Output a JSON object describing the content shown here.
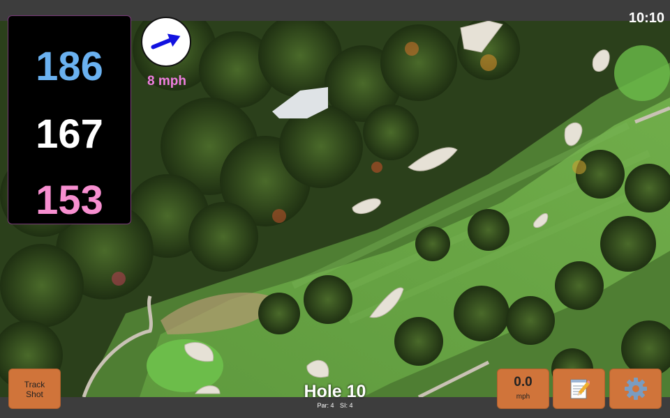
{
  "clock": "10:10",
  "distances": {
    "back": "186",
    "middle": "167",
    "front": "153",
    "back_color": "#6ab1f0",
    "middle_color": "#ffffff",
    "front_color": "#f78fd0"
  },
  "wind": {
    "speed": "8 mph",
    "icon": "arrow-icon",
    "arrow_color": "#1212e0"
  },
  "buttons": {
    "track_shot": "Track Shot",
    "speed_value": "0.0",
    "speed_unit": "mph",
    "notes_icon": "notepad-icon",
    "settings_icon": "gear-icon"
  },
  "hole": {
    "title": "Hole 10",
    "par": "Par: 4",
    "si": "SI: 4"
  },
  "colors": {
    "button": "#d0743a",
    "wind_text": "#f07ee0"
  }
}
